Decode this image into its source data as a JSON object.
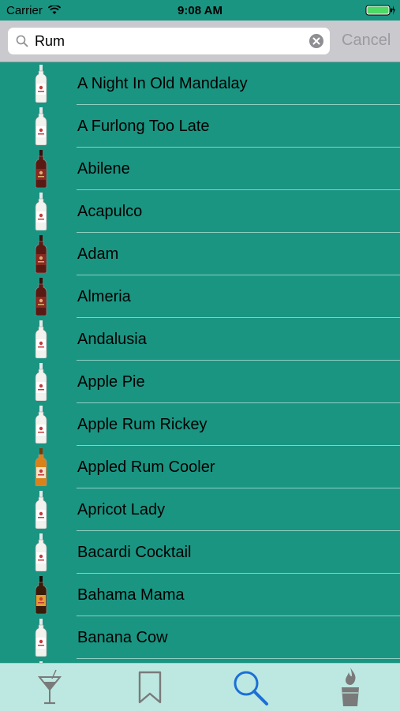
{
  "status": {
    "carrier": "Carrier",
    "time": "9:08 AM",
    "wifi_icon": "wifi-icon",
    "battery_icon": "battery-charging-icon"
  },
  "search": {
    "query": "Rum",
    "cancel_label": "Cancel",
    "icon": "search-icon",
    "clear_icon": "clear-icon"
  },
  "results": [
    {
      "name": "A Night In Old Mandalay",
      "bottle": "white-rum"
    },
    {
      "name": "A Furlong Too Late",
      "bottle": "white-rum"
    },
    {
      "name": "Abilene",
      "bottle": "dark-rum"
    },
    {
      "name": "Acapulco",
      "bottle": "white-rum"
    },
    {
      "name": "Adam",
      "bottle": "dark-rum"
    },
    {
      "name": "Almeria",
      "bottle": "dark-rum"
    },
    {
      "name": "Andalusia",
      "bottle": "white-rum"
    },
    {
      "name": "Apple Pie",
      "bottle": "white-rum"
    },
    {
      "name": "Apple Rum Rickey",
      "bottle": "white-rum"
    },
    {
      "name": "Appled Rum Cooler",
      "bottle": "gold-rum"
    },
    {
      "name": "Apricot Lady",
      "bottle": "white-rum"
    },
    {
      "name": "Bacardi Cocktail",
      "bottle": "white-rum"
    },
    {
      "name": "Bahama Mama",
      "bottle": "spiced-rum"
    },
    {
      "name": "Banana Cow",
      "bottle": "white-rum"
    },
    {
      "name": "",
      "bottle": "white-rum"
    }
  ],
  "tabs": [
    {
      "name": "cocktails",
      "icon": "cocktail-glass-icon",
      "active": false
    },
    {
      "name": "bookmarks",
      "icon": "bookmark-icon",
      "active": false
    },
    {
      "name": "search",
      "icon": "search-icon",
      "active": true
    },
    {
      "name": "flaming-shots",
      "icon": "flaming-shot-icon",
      "active": false
    }
  ],
  "colors": {
    "background": "#1a9582",
    "tab_bar": "#bde8e1",
    "active_tab": "#1c6fd6",
    "inactive_tab": "#7a7a7a",
    "separator": "#8fcfc3"
  }
}
